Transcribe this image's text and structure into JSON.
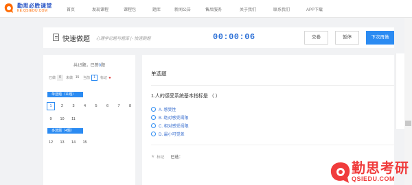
{
  "brand": {
    "name": "勤思必胜课堂",
    "domain": "KE.QSIEDU.COM"
  },
  "nav": {
    "items": [
      "首页",
      "发现课程",
      "课程包",
      "题库",
      "新闻公告",
      "售后服务",
      "关于我们",
      "联系我们",
      "APP下载"
    ]
  },
  "header": {
    "title": "快速做题",
    "subtitle": "心理学论题与题库 (- 快速刷题",
    "timer": "00:00:06",
    "submit_label": "交卷",
    "pause_label": "暂停",
    "next_label": "下次再做"
  },
  "left_panel": {
    "summary_prefix": "共15题，已答",
    "answered": "0",
    "summary_suffix": "题",
    "stats": [
      {
        "label": "已做",
        "value": "0"
      },
      {
        "label": "未做",
        "value": "15"
      },
      {
        "label": "当前",
        "value": "1"
      },
      {
        "label": "标记",
        "value": ""
      }
    ],
    "sections": [
      {
        "label": "单选题（11题）",
        "questions": [
          "1",
          "2",
          "3",
          "4",
          "5",
          "6",
          "7",
          "8",
          "9",
          "10",
          "11"
        ],
        "current": "1"
      },
      {
        "label": "多选题（4题）",
        "questions": [
          "12",
          "13",
          "14",
          "15"
        ]
      }
    ]
  },
  "question": {
    "type": "单选题",
    "text": "1.人的感受系统基本指标是  （ ）",
    "options": [
      {
        "label": "A. 感受性"
      },
      {
        "label": "B. 绝对感受阈限"
      },
      {
        "label": "C. 相对感受阈限"
      },
      {
        "label": "D. 最小可觉差"
      }
    ],
    "mark_label": "标记",
    "chosen_label": "已选："
  },
  "watermark": {
    "cn": "勤思考研",
    "en": "QSIEDU.COM"
  },
  "colors": {
    "accent": "#2b8bf2",
    "timer": "#2b6fd6",
    "brand_red": "#f03c3c"
  }
}
